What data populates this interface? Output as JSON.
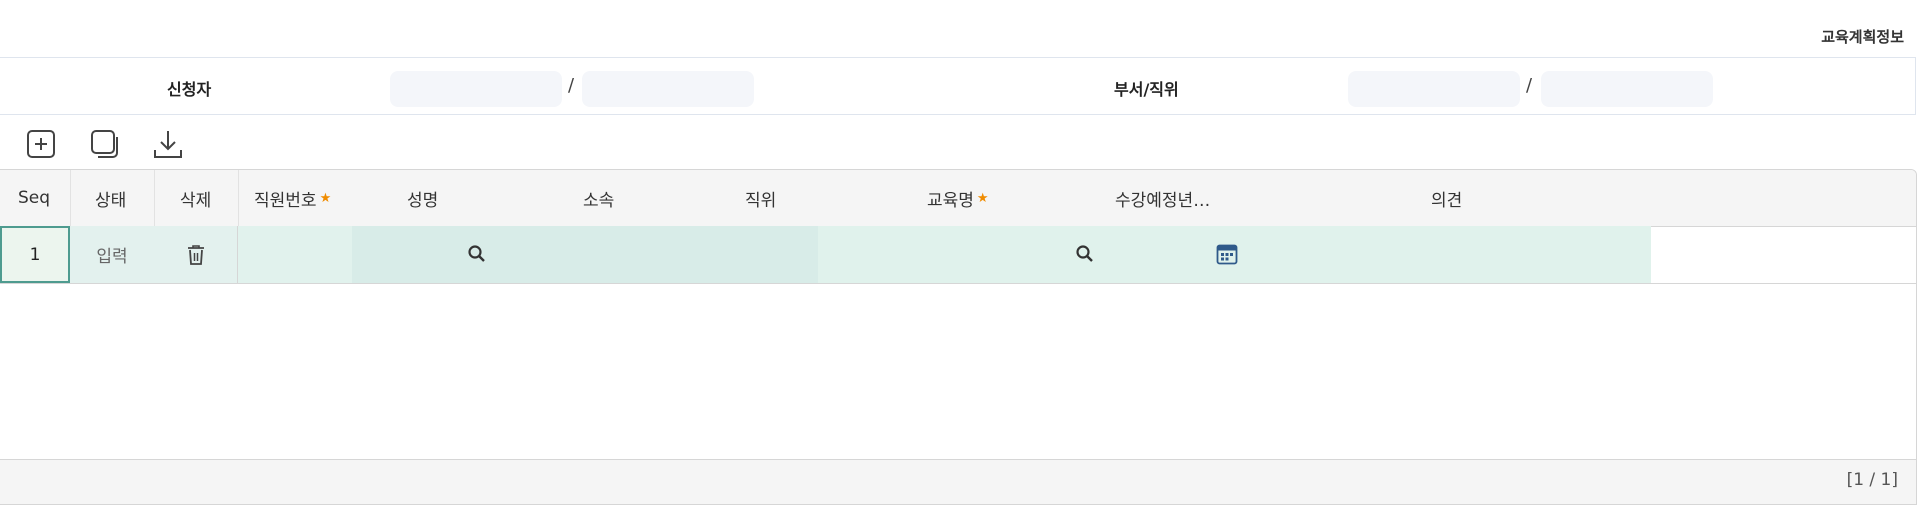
{
  "page_title": "교육계획정보",
  "applicant": {
    "label": "신청자",
    "separator": "/",
    "dept_label": "부서/직위",
    "dept_separator": "/"
  },
  "toolbar": {
    "add_icon": "plus-box-icon",
    "copy_icon": "copy-icon",
    "download_icon": "download-icon"
  },
  "grid": {
    "columns": [
      "Seq",
      "상태",
      "삭제",
      "직원번호",
      "성명",
      "소속",
      "직위",
      "교육명",
      "수강예정년…",
      "의견"
    ],
    "required_mark": "★",
    "rows": [
      {
        "seq": "1",
        "status": "입력"
      }
    ],
    "pager": "[1 / 1]"
  },
  "colors": {
    "accent_border": "#4e9b8f",
    "required": "#f08c00",
    "row_fill": "#e0f2ec"
  }
}
